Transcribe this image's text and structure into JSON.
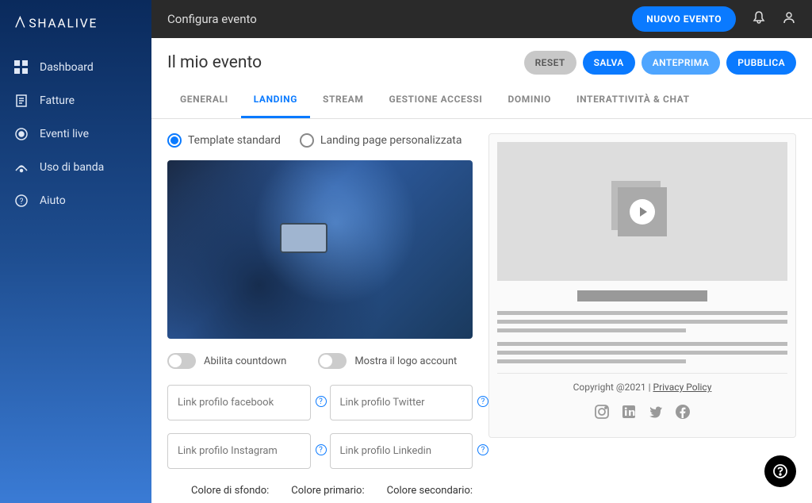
{
  "logo_text": "SHAALIVE",
  "topbar": {
    "title": "Configura evento",
    "new_event_label": "NUOVO EVENTO"
  },
  "sidebar": {
    "items": [
      {
        "label": "Dashboard",
        "icon": "dashboard"
      },
      {
        "label": "Fatture",
        "icon": "invoice"
      },
      {
        "label": "Eventi live",
        "icon": "live"
      },
      {
        "label": "Uso di banda",
        "icon": "bandwidth"
      },
      {
        "label": "Aiuto",
        "icon": "help"
      }
    ]
  },
  "page": {
    "title": "Il mio evento",
    "actions": {
      "reset": "RESET",
      "salva": "SALVA",
      "anteprima": "ANTEPRIMA",
      "pubblica": "PUBBLICA"
    }
  },
  "tabs": [
    "GENERALI",
    "LANDING",
    "STREAM",
    "GESTIONE ACCESSI",
    "DOMINIO",
    "INTERATTIVITÀ & CHAT"
  ],
  "active_tab_index": 1,
  "radio": {
    "standard": "Template standard",
    "custom": "Landing page personalizzata"
  },
  "toggles": {
    "countdown": "Abilita countdown",
    "logo": "Mostra il logo account"
  },
  "inputs": {
    "facebook": "Link profilo facebook",
    "twitter": "Link profilo Twitter",
    "instagram": "Link profilo Instagram",
    "linkedin": "Link profilo Linkedin"
  },
  "colors": {
    "background": "Colore di sfondo:",
    "primary": "Colore primario:",
    "secondary": "Colore secondario:"
  },
  "preview": {
    "copyright": "Copyright @2021 | ",
    "privacy": "Privacy Policy"
  }
}
